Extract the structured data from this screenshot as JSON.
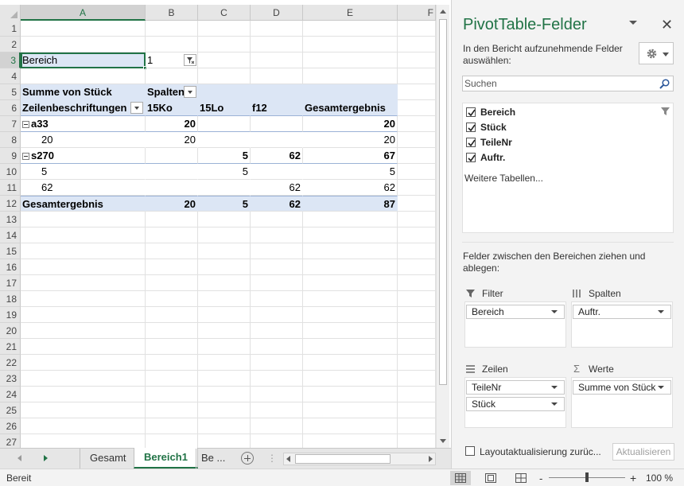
{
  "columns": [
    "A",
    "B",
    "C",
    "D",
    "E",
    "F"
  ],
  "rows": [
    "1",
    "2",
    "3",
    "4",
    "5",
    "6",
    "7",
    "8",
    "9",
    "10",
    "11",
    "12",
    "13",
    "14",
    "15",
    "16",
    "17",
    "18",
    "19",
    "20",
    "21",
    "22",
    "23",
    "24",
    "25",
    "26",
    "27"
  ],
  "cells": {
    "r3": {
      "label": "Bereich",
      "value": "1"
    },
    "r5": {
      "a": "Summe von Stück",
      "b": "Spalten"
    },
    "r6": {
      "a": "Zeilenbeschriftungen",
      "b": "15Ko",
      "c": "15Lo",
      "d": "f12",
      "e": "Gesamtergebnis"
    },
    "r7": {
      "a": "a33",
      "b": "20",
      "e": "20"
    },
    "r8": {
      "a": "20",
      "b": "20",
      "e": "20"
    },
    "r9": {
      "a": "s270",
      "c": "5",
      "d": "62",
      "e": "67"
    },
    "r10": {
      "a": "5",
      "c": "5",
      "e": "5"
    },
    "r11": {
      "a": "62",
      "d": "62",
      "e": "62"
    },
    "r12": {
      "a": "Gesamtergebnis",
      "b": "20",
      "c": "5",
      "d": "62",
      "e": "87"
    }
  },
  "tabs": {
    "sheet1": "Gesamt",
    "sheet2": "Bereich1",
    "sheet3": "Be ...",
    "dots": "⋮"
  },
  "status": {
    "ready": "Bereit",
    "zoom": "100 %",
    "minus": "-",
    "plus": "+"
  },
  "pane": {
    "title": "PivotTable-Felder",
    "subtitle": "In den Bericht aufzunehmende Felder auswählen:",
    "search_placeholder": "Suchen",
    "fields": [
      "Bereich",
      "Stück",
      "TeileNr",
      "Auftr."
    ],
    "more_tables": "Weitere Tabellen...",
    "drag_text": "Felder zwischen den Bereichen ziehen und ablegen:",
    "areas": {
      "filter": {
        "label": "Filter",
        "items": [
          "Bereich"
        ]
      },
      "columns": {
        "label": "Spalten",
        "items": [
          "Auftr."
        ]
      },
      "rows": {
        "label": "Zeilen",
        "items": [
          "TeileNr",
          "Stück"
        ]
      },
      "values": {
        "label": "Werte",
        "items": [
          "Summe von Stück"
        ]
      }
    },
    "defer_label": "Layoutaktualisierung zurüc...",
    "update_button": "Aktualisieren"
  },
  "colors": {
    "accent": "#217346",
    "pivot_header": "#dce6f5"
  }
}
